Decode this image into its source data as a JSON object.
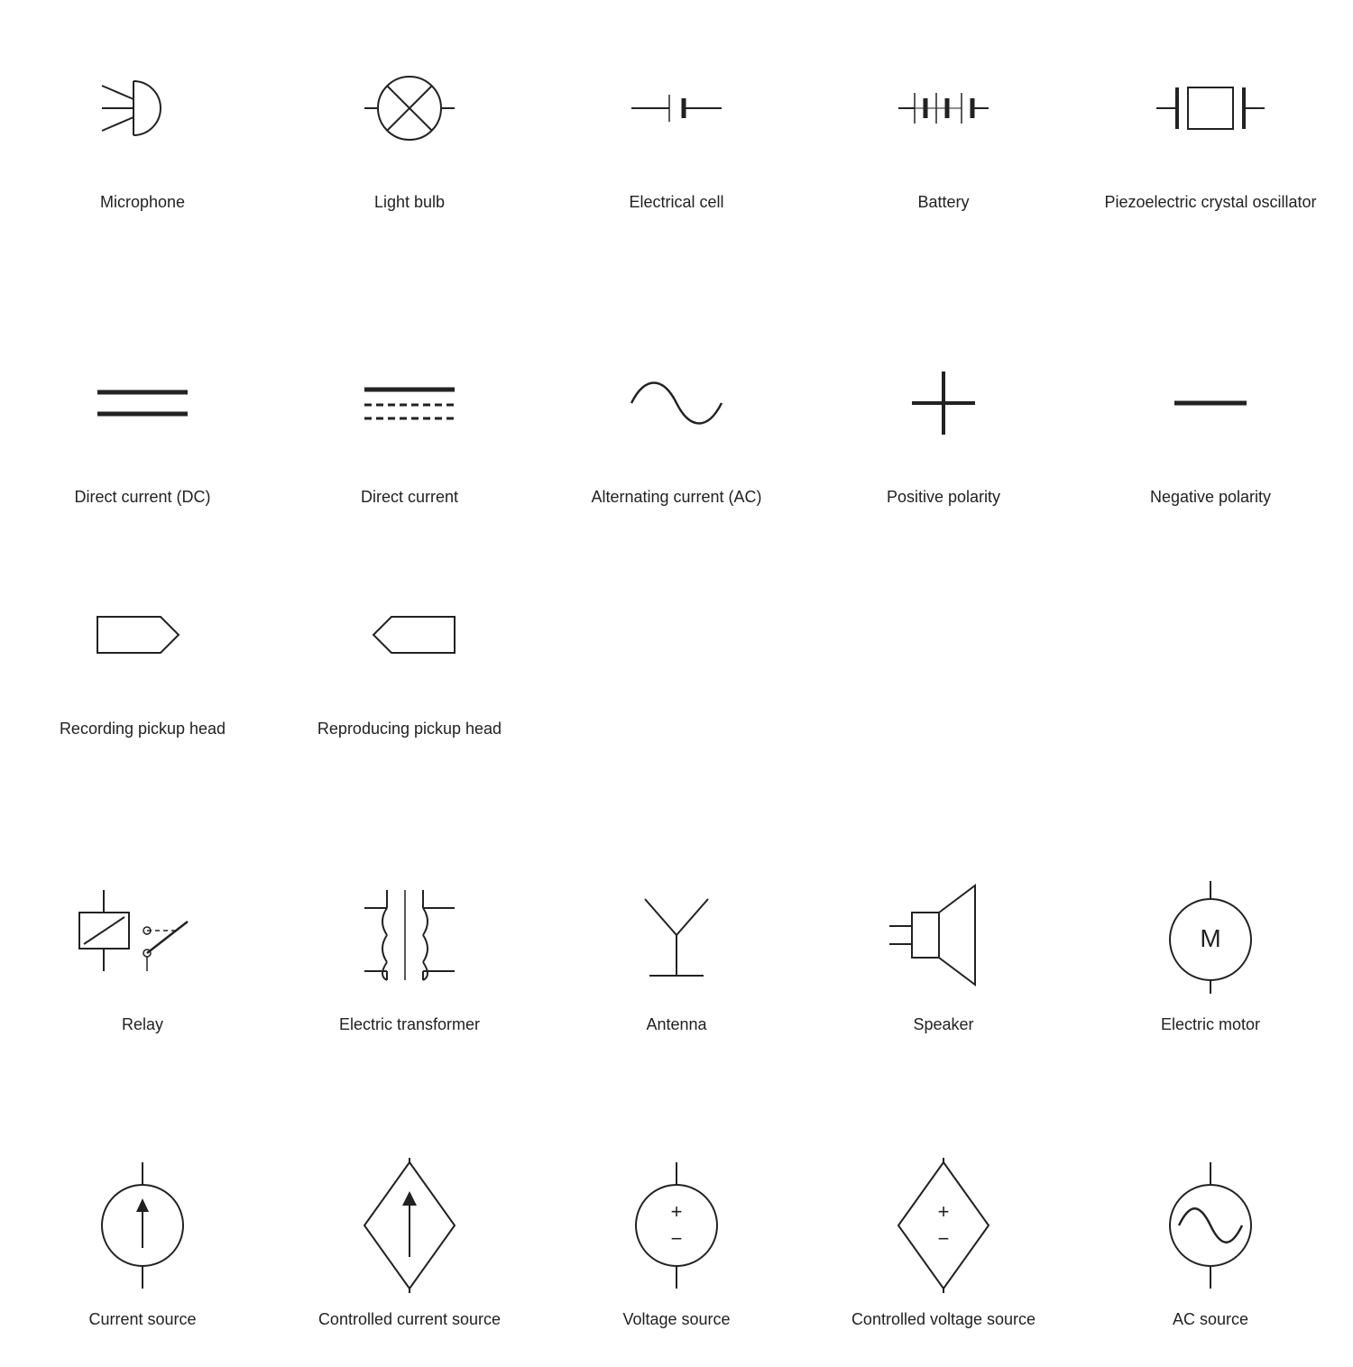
{
  "symbols": [
    {
      "id": "microphone",
      "label": "Microphone"
    },
    {
      "id": "light-bulb",
      "label": "Light bulb"
    },
    {
      "id": "electrical-cell",
      "label": "Electrical cell"
    },
    {
      "id": "battery",
      "label": "Battery"
    },
    {
      "id": "piezoelectric",
      "label": "Piezoelectric\ncrystal oscillator"
    },
    {
      "id": "direct-current-dc",
      "label": "Direct\ncurrent (DC)"
    },
    {
      "id": "direct-current",
      "label": "Direct\ncurrent"
    },
    {
      "id": "alternating-current",
      "label": "Alternating\ncurrent (AC)"
    },
    {
      "id": "positive-polarity",
      "label": "Positive\npolarity"
    },
    {
      "id": "negative-polarity",
      "label": "Negative\npolarity"
    },
    {
      "id": "recording-pickup",
      "label": "Recording\npickup\nhead"
    },
    {
      "id": "reproducing-pickup",
      "label": "Reproducing\npickup\nhead"
    },
    {
      "id": "relay",
      "label": "Relay"
    },
    {
      "id": "electric-transformer",
      "label": "Electric\ntransformer"
    },
    {
      "id": "antenna",
      "label": "Antenna"
    },
    {
      "id": "speaker",
      "label": "Speaker"
    },
    {
      "id": "electric-motor",
      "label": "Electric\nmotor"
    },
    {
      "id": "current-source",
      "label": "Current\nsource"
    },
    {
      "id": "controlled-current-source",
      "label": "Controlled\ncurrent source"
    },
    {
      "id": "voltage-source",
      "label": "Voltage\nsource"
    },
    {
      "id": "controlled-voltage-source",
      "label": "Controlled\nvoltage source"
    },
    {
      "id": "ac-source",
      "label": "AC source"
    }
  ]
}
